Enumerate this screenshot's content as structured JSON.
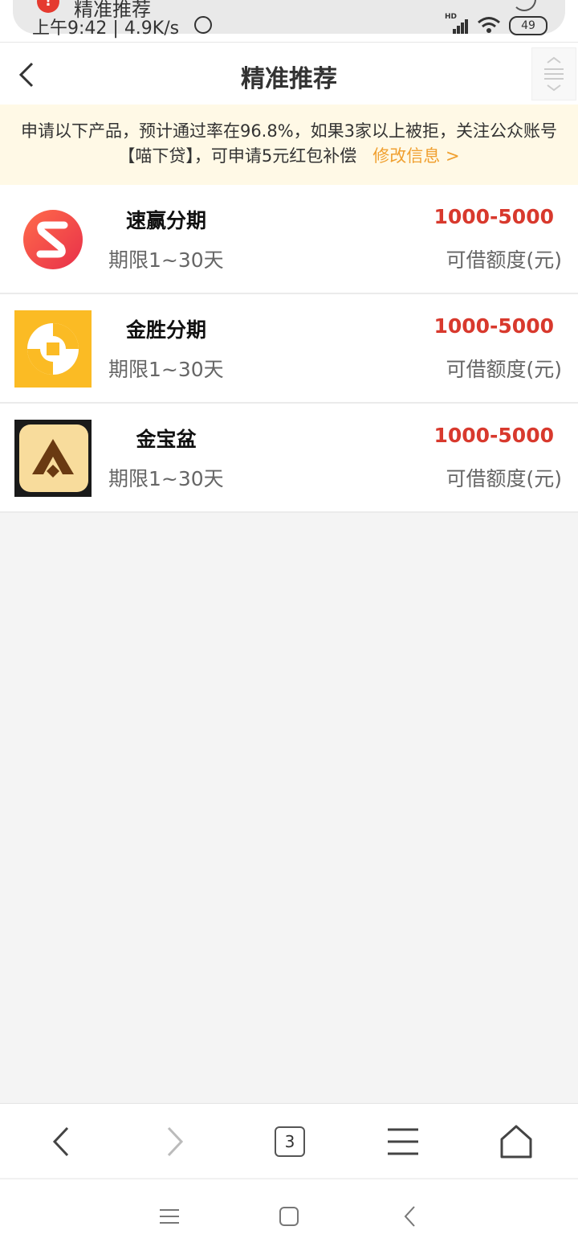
{
  "status_bar": {
    "notification_title": "精准推荐",
    "time": "上午9:42",
    "speed": "4.9K/s",
    "signal_label": "HD",
    "battery": "49"
  },
  "header": {
    "title": "精准推荐"
  },
  "notice": {
    "line1": "申请以下产品，预计通过率在96.8%，如果3家以上被拒，关注公众账号",
    "line2": "【喵下贷】，可申请5元红包补偿",
    "link": "修改信息 >"
  },
  "products": [
    {
      "name": "速赢分期",
      "term": "期限1~30天",
      "amount": "1000-5000",
      "amount_label": "可借额度(元)",
      "logo": "suying-logo"
    },
    {
      "name": "金胜分期",
      "term": "期限1~30天",
      "amount": "1000-5000",
      "amount_label": "可借额度(元)",
      "logo": "jinsheng-logo"
    },
    {
      "name": "金宝盆",
      "term": "期限1~30天",
      "amount": "1000-5000",
      "amount_label": "可借额度(元)",
      "logo": "jinbaopen-logo"
    }
  ],
  "toolbar": {
    "tab_count": "3"
  },
  "colors": {
    "accent_red": "#d8392d",
    "link_orange": "#f0a030",
    "notice_bg": "#fff9e6"
  }
}
